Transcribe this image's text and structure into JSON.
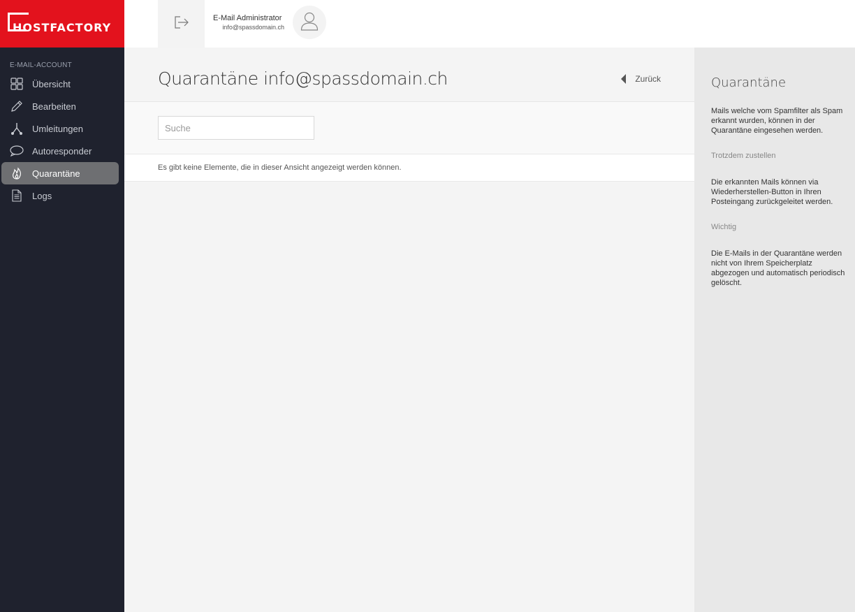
{
  "brand": {
    "name": "HOSTFACTORY",
    "color": "#e3121d"
  },
  "sidebar": {
    "section_label": "E-MAIL-ACCOUNT",
    "items": [
      {
        "label": "Übersicht",
        "icon": "grid-icon"
      },
      {
        "label": "Bearbeiten",
        "icon": "pencil-icon"
      },
      {
        "label": "Umleitungen",
        "icon": "fork-icon"
      },
      {
        "label": "Autoresponder",
        "icon": "speech-bubble-icon"
      },
      {
        "label": "Quarantäne",
        "icon": "flame-icon",
        "active": true
      },
      {
        "label": "Logs",
        "icon": "document-icon"
      }
    ]
  },
  "header": {
    "user_name": "E-Mail Administrator",
    "user_email": "info@spassdomain.ch"
  },
  "main": {
    "title": "Quarantäne info@spassdomain.ch",
    "back_label": "Zurück",
    "search_placeholder": "Suche",
    "empty_message": "Es gibt keine Elemente, die in dieser Ansicht angezeigt werden können."
  },
  "help": {
    "title": "Quarantäne",
    "intro": "Mails welche vom Spamfilter als Spam erkannt wurden, können in der Quarantäne eingesehen werden.",
    "sections": [
      {
        "heading": "Trotzdem zustellen",
        "text": "Die erkannten Mails können via Wiederherstellen-Button in Ihren Posteingang zurückgeleitet werden."
      },
      {
        "heading": "Wichtig",
        "text": "Die E-Mails in der Quarantäne werden nicht von Ihrem Speicherplatz abgezogen und automatisch periodisch gelöscht."
      }
    ]
  }
}
